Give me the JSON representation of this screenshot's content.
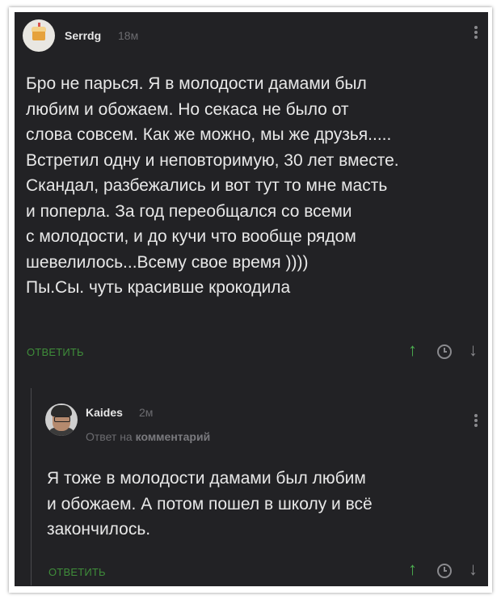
{
  "comment": {
    "author": "Serrdg",
    "time": "18м",
    "lines": [
      "Бро не парься. Я в молодости дамами был",
      "любим и обожаем. Но секаса не было от",
      "слова совсем. Как же можно, мы же друзья.....",
      "Встретил одну и неповторимую, 30 лет вместе.",
      "Скандал, разбежались и вот тут то мне масть",
      "и поперла. За год переобщался со всеми",
      "с молодости, и до кучи что вообще рядом",
      "шевелилось...Всему свое время ))))",
      "Пы.Сы. чуть красивше крокодила"
    ],
    "reply_label": "ОТВЕТИТЬ"
  },
  "reply": {
    "author": "Kaides",
    "time": "2м",
    "reply_to_prefix": "Ответ на",
    "reply_to_target": "комментарий",
    "lines": [
      "Я тоже в молодости дамами был любим",
      "и обожаем. А потом пошел в школу и всё",
      "закончилось."
    ],
    "reply_label": "ОТВЕТИТЬ"
  },
  "icons": {
    "upvote": "↑",
    "downvote": "↓"
  },
  "colors": {
    "background": "#222225",
    "accent_green": "#3f8d3a",
    "text": "#e8e8e8",
    "muted": "#6c6c70"
  }
}
